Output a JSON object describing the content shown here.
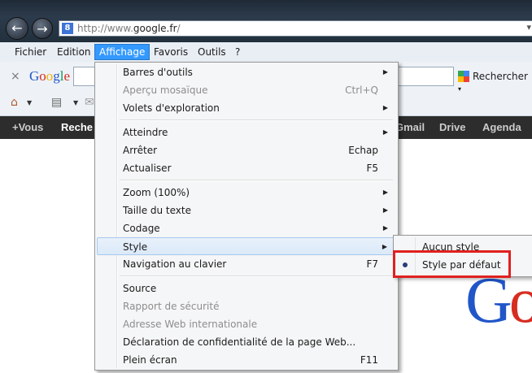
{
  "browser": {
    "address": "http://www.google.fr/",
    "address_prefix": "http://www.",
    "address_domain": "google.fr",
    "address_suffix": "/"
  },
  "menubar": {
    "items": [
      "Fichier",
      "Edition",
      "Affichage",
      "Favoris",
      "Outils",
      "?"
    ],
    "active": "Affichage"
  },
  "google_toolbar": {
    "logo": "Google",
    "search_value": "",
    "search_button": "Rechercher"
  },
  "gbar": {
    "items": [
      "+Vous",
      "Reche",
      "Gmail",
      "Drive",
      "Agenda"
    ]
  },
  "view_menu": {
    "items": [
      {
        "label": "Barres d'outils",
        "shortcut": "",
        "submenu": true,
        "disabled": false
      },
      {
        "label": "Aperçu mosaïque",
        "shortcut": "Ctrl+Q",
        "submenu": false,
        "disabled": true
      },
      {
        "label": "Volets d'exploration",
        "shortcut": "",
        "submenu": true,
        "disabled": false
      },
      {
        "label": "Atteindre",
        "shortcut": "",
        "submenu": true,
        "disabled": false
      },
      {
        "label": "Arrêter",
        "shortcut": "Echap",
        "submenu": false,
        "disabled": false
      },
      {
        "label": "Actualiser",
        "shortcut": "F5",
        "submenu": false,
        "disabled": false
      },
      {
        "label": "Zoom (100%)",
        "shortcut": "",
        "submenu": true,
        "disabled": false
      },
      {
        "label": "Taille du texte",
        "shortcut": "",
        "submenu": true,
        "disabled": false
      },
      {
        "label": "Codage",
        "shortcut": "",
        "submenu": true,
        "disabled": false
      },
      {
        "label": "Style",
        "shortcut": "",
        "submenu": true,
        "disabled": false,
        "highlighted": true
      },
      {
        "label": "Navigation au clavier",
        "shortcut": "F7",
        "submenu": false,
        "disabled": false
      },
      {
        "label": "Source",
        "shortcut": "",
        "submenu": false,
        "disabled": false
      },
      {
        "label": "Rapport de sécurité",
        "shortcut": "",
        "submenu": false,
        "disabled": true
      },
      {
        "label": "Adresse Web internationale",
        "shortcut": "",
        "submenu": false,
        "disabled": true
      },
      {
        "label": "Déclaration de confidentialité de la page Web...",
        "shortcut": "",
        "submenu": false,
        "disabled": false
      },
      {
        "label": "Plein écran",
        "shortcut": "F11",
        "submenu": false,
        "disabled": false
      }
    ]
  },
  "style_submenu": {
    "items": [
      {
        "label": "Aucun style",
        "selected": false
      },
      {
        "label": "Style par défaut",
        "selected": true
      }
    ]
  },
  "page": {
    "logo_partial": "Go"
  },
  "colors": {
    "menu_active": "#3399ff",
    "highlight_box": "#e02020",
    "gbar_bg": "#2d2d2d"
  }
}
